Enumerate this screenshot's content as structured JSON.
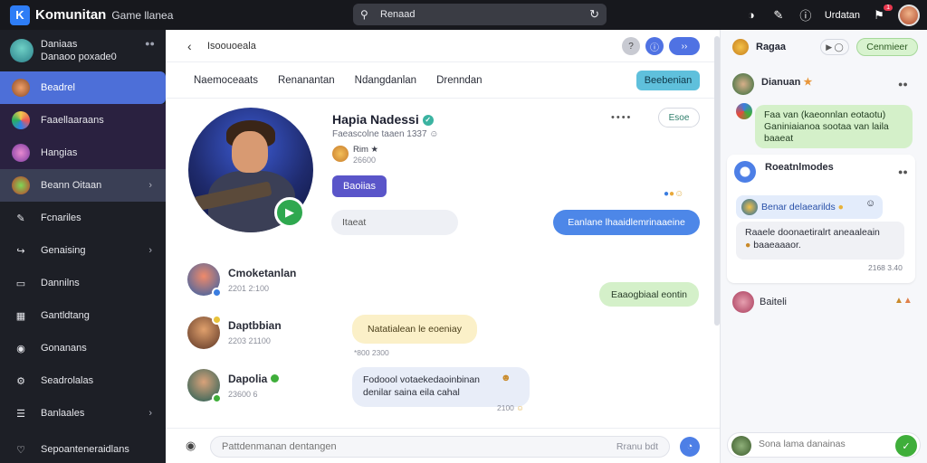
{
  "topbar": {
    "app_title": "Komunitan",
    "app_subtitle": "Game llanea",
    "search_value": "Renaad",
    "user_name": "Urdatan",
    "notif_count": "1"
  },
  "sidebar": {
    "profile_line1": "Daniaas",
    "profile_line2": "Danaoo poxade0",
    "items": [
      {
        "label": "Beadrel",
        "icon": "avatar"
      },
      {
        "label": "Faaellaaraans",
        "icon": "avatar"
      },
      {
        "label": "Hangias",
        "icon": "avatar"
      },
      {
        "label": "Beann Oitaan",
        "icon": "avatar"
      },
      {
        "label": "Fcnariles",
        "icon": "pencil-icon"
      },
      {
        "label": "Genaising",
        "icon": "link-icon"
      },
      {
        "label": "Dannilns",
        "icon": "chat-icon"
      },
      {
        "label": "Gantldtang",
        "icon": "chart-icon"
      },
      {
        "label": "Gonanans",
        "icon": "camera-icon"
      },
      {
        "label": "Seadrolalas",
        "icon": "gear-icon"
      },
      {
        "label": "Banlaales",
        "icon": "list-icon"
      },
      {
        "label": "Sepoanteneraidlans",
        "icon": "heart-icon"
      }
    ]
  },
  "middle": {
    "breadcrumb": "Isoouoeala",
    "tabs": [
      "Naemoceaats",
      "Renanantan",
      "Ndangdanlan",
      "Drenndan"
    ],
    "tab_button": "Beebenian",
    "profile": {
      "name": "Hapia Nadessi",
      "meta": "Faeascolne taaen 1337",
      "friend1": "Rim",
      "friend2": "26600",
      "follow_label": "Baoiias",
      "close_label": "Esoe"
    },
    "bubble_in_placeholder": "Itaeat",
    "bubble_out": "Eanlane lhaaidlemrinaaeine",
    "messages": [
      {
        "name": "Cmoketanlan",
        "time": "2201 2:100"
      },
      {
        "name": "Daptbbian",
        "time": "2203 21100"
      },
      {
        "name": "Dapolia",
        "time": "23600 6"
      }
    ],
    "bubble_green": "Eaaogbiaal eontin",
    "bubble_yellow": "Natatialean le eoeniay",
    "bubble_yellow_time": "*800 2300",
    "bubble_blue_line1": "Fodoool votaekedaoinbinan",
    "bubble_blue_line2": "denilar saina eila cahal",
    "bubble_blue_time": "2100",
    "composer_placeholder": "Pattdenmanan dentangen",
    "composer_hint": "Rranu bdt"
  },
  "right": {
    "header_title": "Ragaa",
    "header_button": "Cenmieer",
    "user1": "Dianuan",
    "bubble1": "Faa van (kaeonnlan eotaotu) Ganiniaianoa sootaa van laila baaeat",
    "user2": "Roeatnlmodes",
    "bubble_blue": "Benar delaearilds",
    "bubble_white_line1": "Raaele doonaetiralrt aneaaleain",
    "bubble_white_line2": "baaeaaaor.",
    "card_time": "2168 3.40",
    "user3": "Baiteli",
    "composer_placeholder": "Sona lama danainas"
  },
  "colors": {
    "accent": "#4d6fd8",
    "sidebar_bg": "#1d1f26",
    "topbar_bg": "#17181d",
    "green": "#3fae3a"
  }
}
